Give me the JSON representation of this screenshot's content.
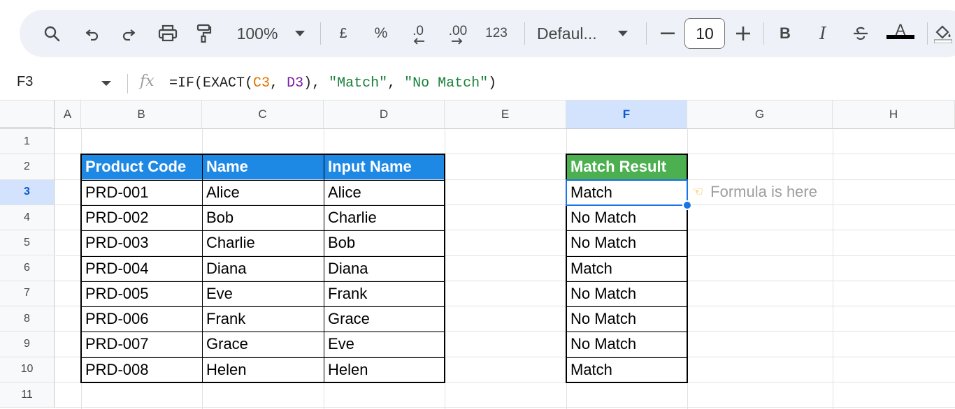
{
  "toolbar": {
    "zoom": "100%",
    "currency": "£",
    "percent": "%",
    "decrease_decimal": ".0",
    "increase_decimal": ".00",
    "number_format": "123",
    "font": "Defaul...",
    "font_size": "10",
    "bold": "B",
    "italic": "I",
    "text_color": "A"
  },
  "formula_bar": {
    "name_box": "F3",
    "fx": "fx",
    "formula_prefix": "=IF(EXACT(",
    "formula_c3": "C3",
    "formula_sep": ", ",
    "formula_d3": "D3",
    "formula_mid": "), ",
    "formula_str1": "\"Match\"",
    "formula_comma": ", ",
    "formula_str2": "\"No Match\"",
    "formula_end": ")"
  },
  "columns": [
    "A",
    "B",
    "C",
    "D",
    "E",
    "F",
    "G",
    "H"
  ],
  "rows": [
    "1",
    "2",
    "3",
    "4",
    "5",
    "6",
    "7",
    "8",
    "9",
    "10",
    "11"
  ],
  "table": {
    "headers": [
      "Product Code",
      "Name",
      "Input Name"
    ],
    "rows": [
      [
        "PRD-001",
        "Alice",
        "Alice"
      ],
      [
        "PRD-002",
        "Bob",
        "Charlie"
      ],
      [
        "PRD-003",
        "Charlie",
        "Bob"
      ],
      [
        "PRD-004",
        "Diana",
        "Diana"
      ],
      [
        "PRD-005",
        "Eve",
        "Frank"
      ],
      [
        "PRD-006",
        "Frank",
        "Grace"
      ],
      [
        "PRD-007",
        "Grace",
        "Eve"
      ],
      [
        "PRD-008",
        "Helen",
        "Helen"
      ]
    ]
  },
  "results": {
    "header": "Match Result",
    "values": [
      "Match",
      "No Match",
      "No Match",
      "Match",
      "No Match",
      "No Match",
      "No Match",
      "Match"
    ]
  },
  "note": {
    "text": "Formula is here"
  },
  "colors": {
    "header_blue": "#1e88e5",
    "header_green": "#4caf50",
    "selection": "#1a73e8"
  }
}
